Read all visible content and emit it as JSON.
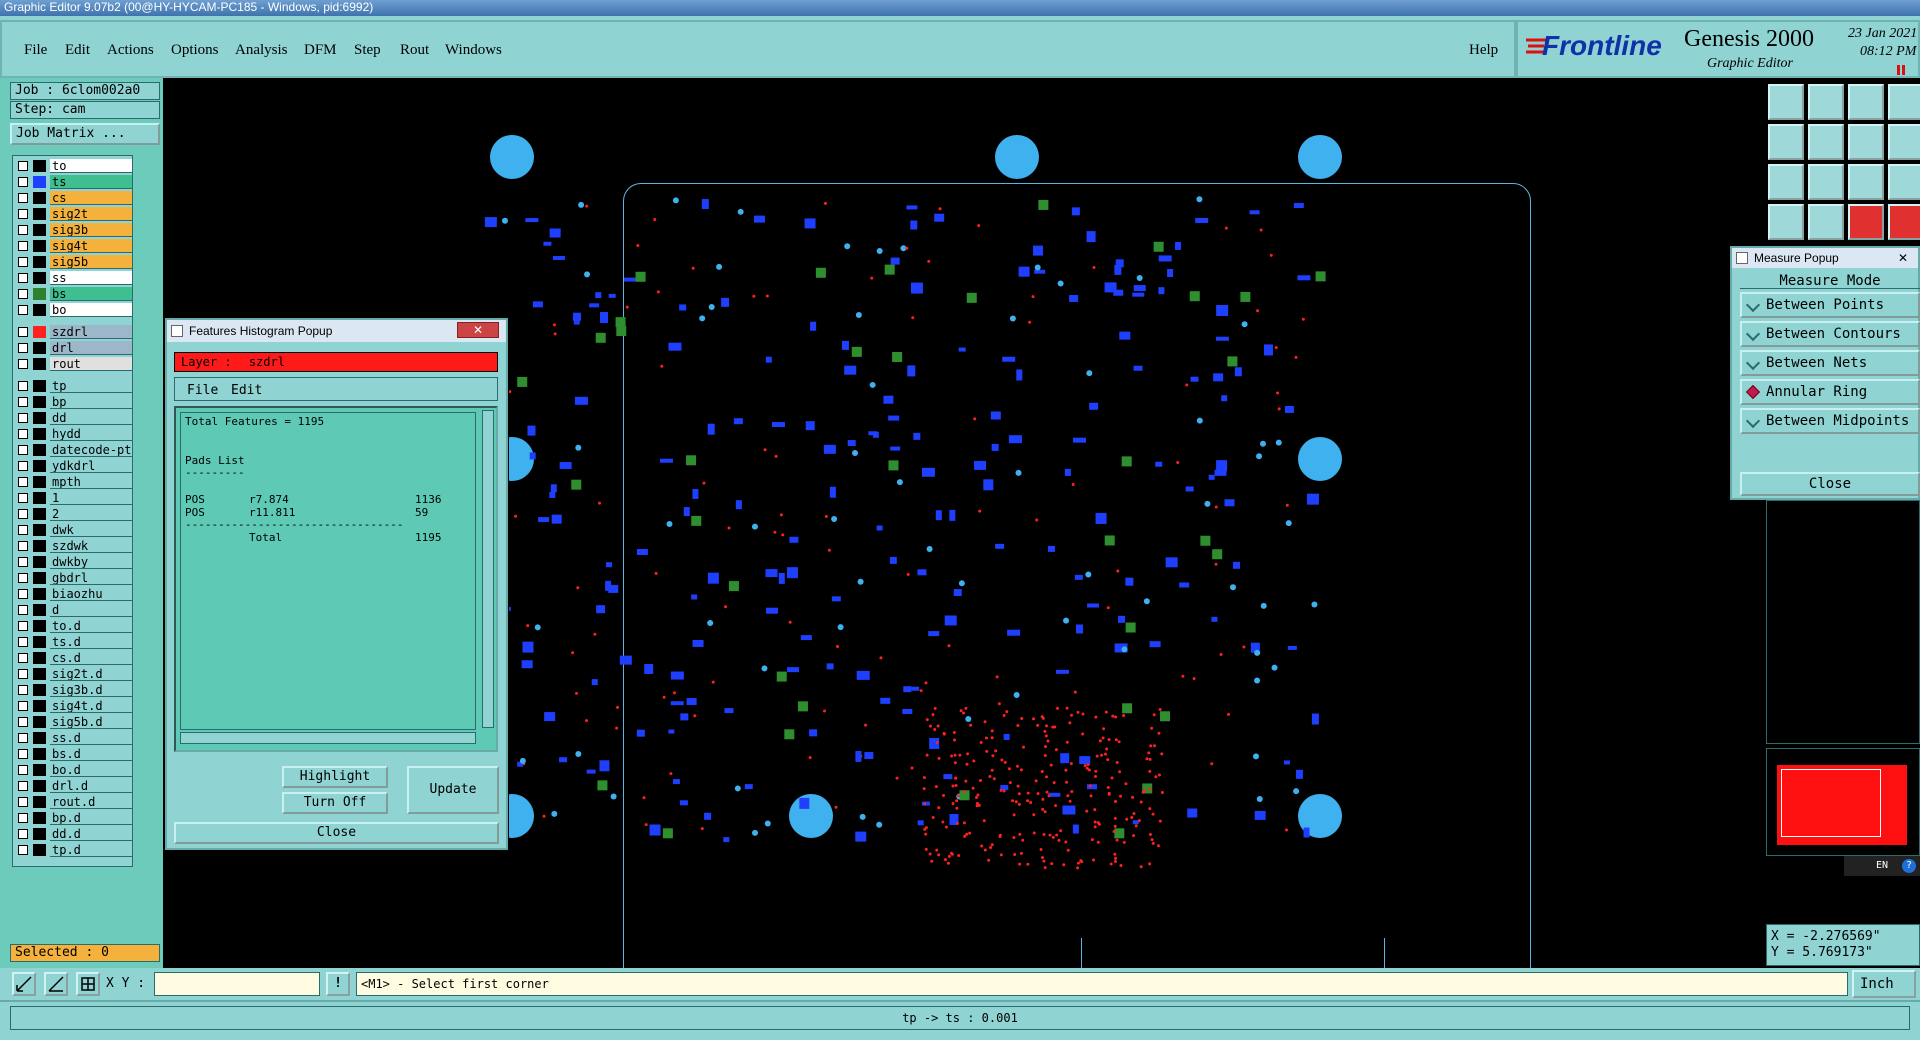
{
  "window": {
    "title": "Graphic Editor 9.07b2 (00@HY-HYCAM-PC185 - Windows, pid:6992)"
  },
  "menu": {
    "items": [
      "File",
      "Edit",
      "Actions",
      "Options",
      "Analysis",
      "DFM",
      "Step",
      "Rout",
      "Windows"
    ],
    "help": "Help"
  },
  "brand": {
    "logo": "Frontline",
    "product": "Genesis 2000",
    "subtitle": "Graphic Editor",
    "date": "23 Jan 2021",
    "time": "08:12 PM"
  },
  "job": {
    "label": "Job : 6clom002a0",
    "step": "Step: cam",
    "matrix_button": "Job Matrix ..."
  },
  "layers": [
    {
      "name": "to",
      "color": "#000000",
      "bg": "#ffffff"
    },
    {
      "name": "ts",
      "color": "#1f3fff",
      "bg": "#3fbf8f"
    },
    {
      "name": "cs",
      "color": "#000000",
      "bg": "#f4b13b"
    },
    {
      "name": "sig2t",
      "color": "#000000",
      "bg": "#f4b13b"
    },
    {
      "name": "sig3b",
      "color": "#000000",
      "bg": "#f4b13b"
    },
    {
      "name": "sig4t",
      "color": "#000000",
      "bg": "#f4b13b"
    },
    {
      "name": "sig5b",
      "color": "#000000",
      "bg": "#f4b13b"
    },
    {
      "name": "ss",
      "color": "#000000",
      "bg": "#ffffff"
    },
    {
      "name": "bs",
      "color": "#2f7f2f",
      "bg": "#3fbf8f"
    },
    {
      "name": "bo",
      "color": "#000000",
      "bg": "#ffffff"
    },
    {
      "name": "szdrl",
      "color": "#ff2020",
      "bg": "#9cb7c9"
    },
    {
      "name": "drl",
      "color": "#000000",
      "bg": "#9cb7c9"
    },
    {
      "name": "rout",
      "color": "#000000",
      "bg": "#e0e0e0"
    },
    {
      "name": "tp",
      "color": "#000000",
      "bg": "#8fd3d3"
    },
    {
      "name": "bp",
      "color": "#000000",
      "bg": "#8fd3d3"
    },
    {
      "name": "dd",
      "color": "#000000",
      "bg": "#8fd3d3"
    },
    {
      "name": "hydd",
      "color": "#000000",
      "bg": "#8fd3d3"
    },
    {
      "name": "datecode-pte",
      "color": "#000000",
      "bg": "#8fd3d3"
    },
    {
      "name": "ydkdrl",
      "color": "#000000",
      "bg": "#8fd3d3"
    },
    {
      "name": "mpth",
      "color": "#000000",
      "bg": "#8fd3d3"
    },
    {
      "name": "1",
      "color": "#000000",
      "bg": "#8fd3d3"
    },
    {
      "name": "2",
      "color": "#000000",
      "bg": "#8fd3d3"
    },
    {
      "name": "dwk",
      "color": "#000000",
      "bg": "#8fd3d3"
    },
    {
      "name": "szdwk",
      "color": "#000000",
      "bg": "#8fd3d3"
    },
    {
      "name": "dwkby",
      "color": "#000000",
      "bg": "#8fd3d3"
    },
    {
      "name": "gbdrl",
      "color": "#000000",
      "bg": "#8fd3d3"
    },
    {
      "name": "biaozhu",
      "color": "#000000",
      "bg": "#8fd3d3"
    },
    {
      "name": "d",
      "color": "#000000",
      "bg": "#8fd3d3"
    },
    {
      "name": "to.d",
      "color": "#000000",
      "bg": "#8fd3d3"
    },
    {
      "name": "ts.d",
      "color": "#000000",
      "bg": "#8fd3d3"
    },
    {
      "name": "cs.d",
      "color": "#000000",
      "bg": "#8fd3d3"
    },
    {
      "name": "sig2t.d",
      "color": "#000000",
      "bg": "#8fd3d3"
    },
    {
      "name": "sig3b.d",
      "color": "#000000",
      "bg": "#8fd3d3"
    },
    {
      "name": "sig4t.d",
      "color": "#000000",
      "bg": "#8fd3d3"
    },
    {
      "name": "sig5b.d",
      "color": "#000000",
      "bg": "#8fd3d3"
    },
    {
      "name": "ss.d",
      "color": "#000000",
      "bg": "#8fd3d3"
    },
    {
      "name": "bs.d",
      "color": "#000000",
      "bg": "#8fd3d3"
    },
    {
      "name": "bo.d",
      "color": "#000000",
      "bg": "#8fd3d3"
    },
    {
      "name": "drl.d",
      "color": "#000000",
      "bg": "#8fd3d3"
    },
    {
      "name": "rout.d",
      "color": "#000000",
      "bg": "#8fd3d3"
    },
    {
      "name": "bp.d",
      "color": "#000000",
      "bg": "#8fd3d3"
    },
    {
      "name": "dd.d",
      "color": "#000000",
      "bg": "#8fd3d3"
    },
    {
      "name": "tp.d",
      "color": "#000000",
      "bg": "#8fd3d3"
    }
  ],
  "selected": "Selected : 0",
  "histogram": {
    "title": "Features Histogram Popup",
    "layer_label": "Layer :",
    "layer_value": "szdrl",
    "menu": [
      "File",
      "Edit"
    ],
    "total": "Total Features = 1195",
    "pads_header": "Pads List",
    "pads_rule": "---------",
    "rows": [
      {
        "type": "POS",
        "sym": "r7.874",
        "count": "1136"
      },
      {
        "type": "POS",
        "sym": "r11.811",
        "count": "59"
      }
    ],
    "rule": "---------------------------------",
    "total_label": "Total",
    "total_value": "1195",
    "buttons": {
      "highlight": "Highlight",
      "turn_off": "Turn Off",
      "update": "Update",
      "close": "Close"
    }
  },
  "measure": {
    "title": "Measure Popup",
    "header": "Measure Mode",
    "options": [
      "Between Points",
      "Between Contours",
      "Between Nets",
      "Annular Ring",
      "Between Midpoints"
    ],
    "selected_index": 3,
    "close": "Close"
  },
  "coords": {
    "x": "X = -2.276569\"",
    "y": "Y =  5.769173\""
  },
  "lang": {
    "code": "EN"
  },
  "status": {
    "xy_label": "X Y :",
    "xy_value": "",
    "prompt": "<M1> - Select first corner",
    "units": "Inch",
    "bottom": "tp -> ts : 0.001"
  },
  "colors": {
    "teal": "#8fd3d3",
    "canvas": "#000000",
    "pad_blue": "#1f3fff",
    "pad_green": "#2f8f2f",
    "drill_red": "#ff2020",
    "tooling": "#3fb1ef"
  }
}
